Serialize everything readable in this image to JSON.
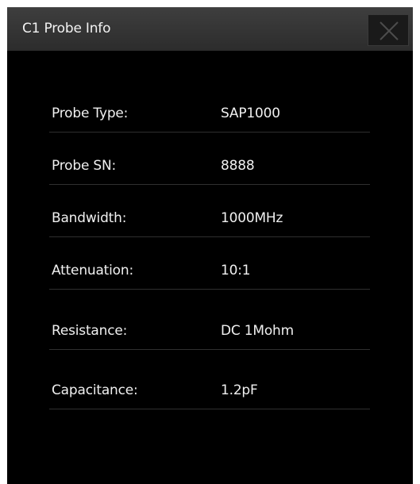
{
  "dialog": {
    "title": "C1 Probe Info",
    "close_icon": "close-icon"
  },
  "rows": [
    {
      "label": "Probe Type:",
      "value": "SAP1000"
    },
    {
      "label": "Probe SN:",
      "value": "8888"
    },
    {
      "label": "Bandwidth:",
      "value": "1000MHz"
    },
    {
      "label": "Attenuation:",
      "value": "10:1"
    },
    {
      "label": "Resistance:",
      "value": "DC 1Mohm"
    },
    {
      "label": "Capacitance:",
      "value": "1.2pF"
    }
  ],
  "colors": {
    "background": "#000000",
    "titlebar": "#353535",
    "text": "#f0f0f0",
    "divider": "#2f2f2f"
  }
}
